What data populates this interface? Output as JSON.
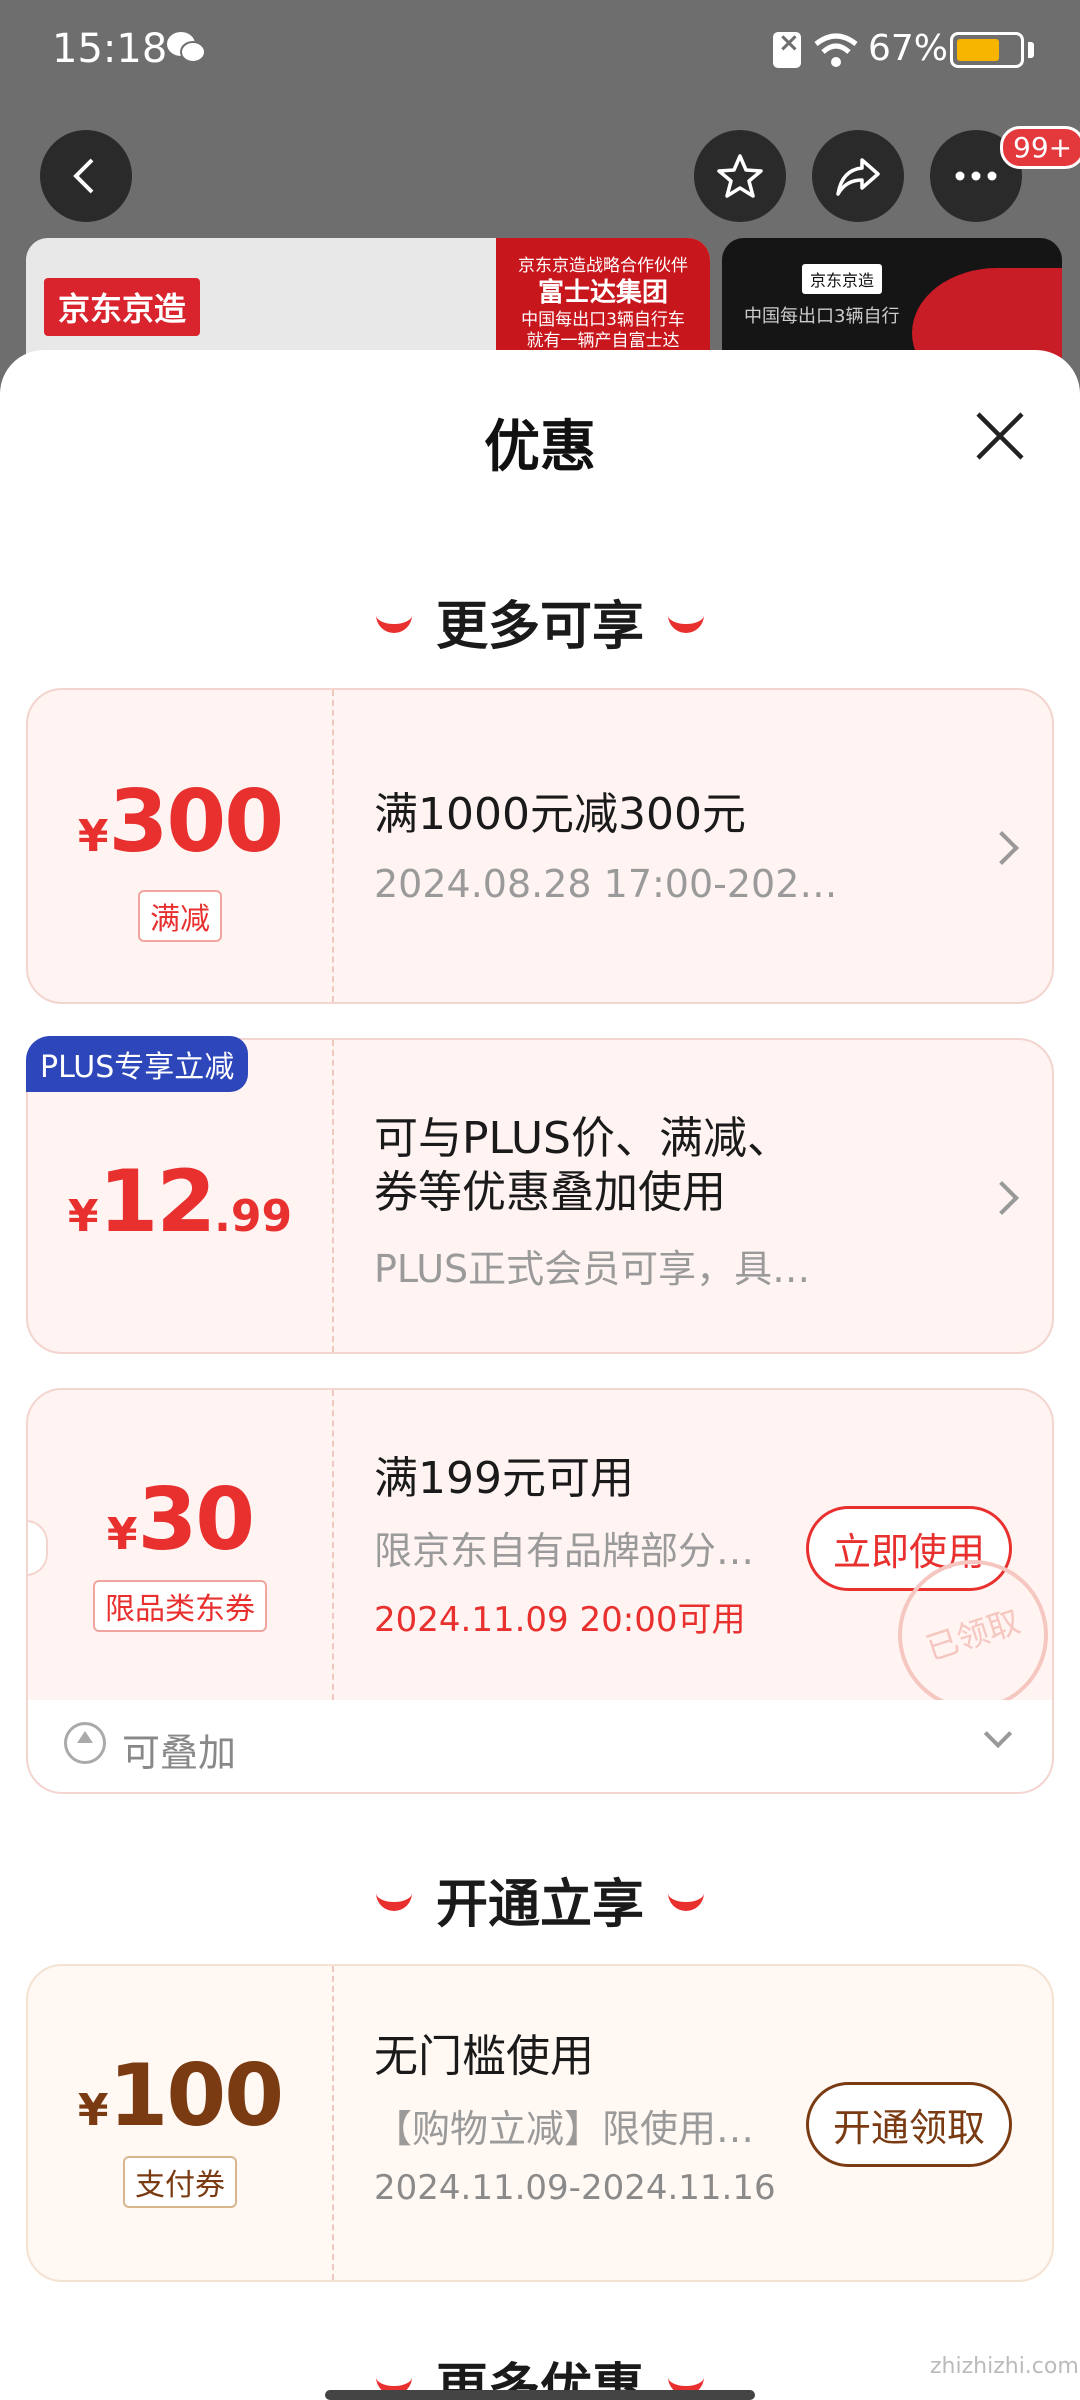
{
  "status_bar": {
    "time": "15:18",
    "battery_pct": "67%",
    "battery_level": 0.67
  },
  "header": {
    "badge": "99+"
  },
  "banner": {
    "logo": "京东京造",
    "partner_small": "京东京造战略合作伙伴",
    "partner_big": "富士达集团",
    "partner_line1": "中国每出口3辆自行车",
    "partner_line2": "就有一辆产自富士达",
    "thumb_tag": "京东京造",
    "thumb_text": "中国每出口3辆自行"
  },
  "sheet": {
    "title": "优惠"
  },
  "sections": {
    "more_enjoy": "更多可享",
    "open_enjoy": "开通立享",
    "more_offers": "更多优惠"
  },
  "cards": [
    {
      "currency": "¥",
      "amount": "300",
      "chip": "满减",
      "title": "满1000元减300元",
      "sub": "2024.08.28 17:00-202…"
    },
    {
      "tag": "PLUS专享立减",
      "currency": "¥",
      "amount": "12",
      "decimal": ".99",
      "title_line1": "可与PLUS价、满减、",
      "title_line2": "券等优惠叠加使用",
      "sub": "PLUS正式会员可享，具…"
    },
    {
      "currency": "¥",
      "amount": "30",
      "chip": "限品类东券",
      "title": "满199元可用",
      "sub": "限京东自有品牌部分…",
      "date": "2024.11.09 20:00可用",
      "action": "立即使用",
      "stamp": "已领取",
      "stack_label": "可叠加"
    },
    {
      "currency": "¥",
      "amount": "100",
      "chip": "支付券",
      "title": "无门槛使用",
      "sub": "【购物立减】限使用…",
      "date": "2024.11.09-2024.11.16",
      "action": "开通领取"
    }
  ],
  "watermark": "zhizhizhi.com",
  "colors": {
    "accent": "#e8302f",
    "plus_blue": "#2d46b9",
    "gold_brown": "#7a3b12"
  }
}
